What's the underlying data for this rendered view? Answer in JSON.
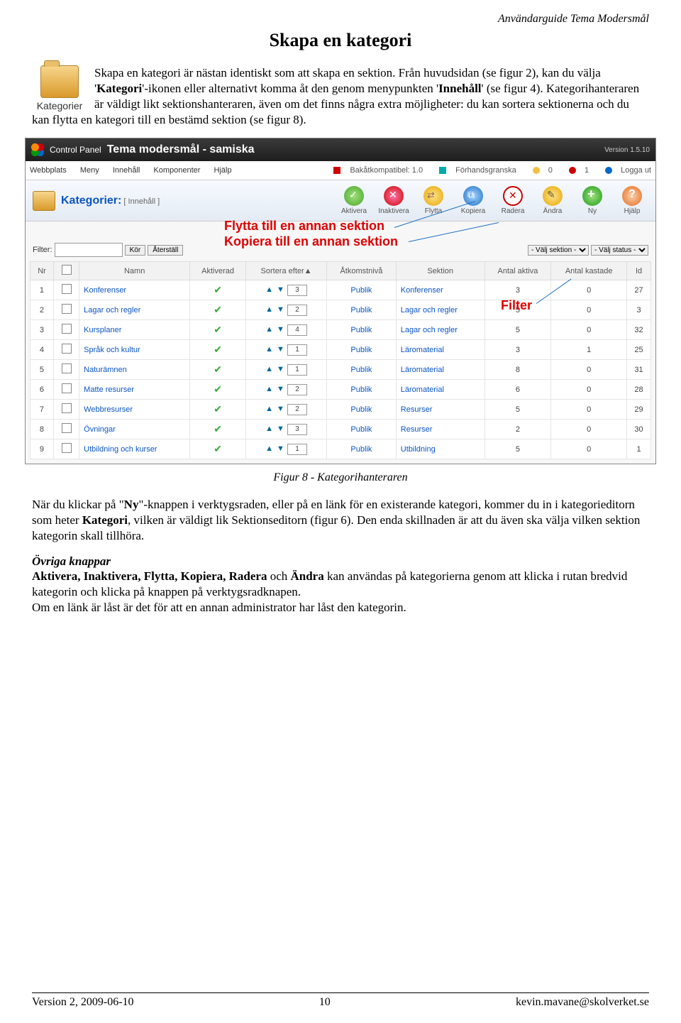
{
  "doc": {
    "header_right": "Användarguide Tema Modersmål",
    "title": "Skapa en kategori",
    "icon_caption": "Kategorier",
    "intro_1": "Skapa en kategori är nästan identiskt som att skapa en sektion. Från huvudsidan (se figur 2), kan du välja '",
    "intro_b1": "Kategori",
    "intro_2": "'-ikonen eller alternativt komma åt den genom menypunkten '",
    "intro_b2": "Innehåll",
    "intro_3": "' (se figur 4). Kategorihanteraren är väldigt likt sektionshanteraren, även om det finns några extra möjligheter: du kan sortera sektionerna och du kan flytta en kategori till en bestämd sektion (se figur 8).",
    "caption": "Figur 8 - Kategorihanteraren",
    "p2_1": "När du klickar på \"",
    "p2_b1": "Ny",
    "p2_2": "\"-knappen i verktygsraden, eller på en länk för en existerande kategori, kommer du in i kategorieditorn som heter ",
    "p2_b2": "Kategori",
    "p2_3": ", vilken är väldigt lik Sektionseditorn (figur 6). Den enda skillnaden är att du även ska välja vilken sektion kategorin skall tillhöra.",
    "p3_h": "Övriga knappar",
    "p3_b": "Aktivera, Inaktivera, Flytta,  Kopiera, Radera",
    "p3_1": " och ",
    "p3_b2": "Ändra",
    "p3_2": " kan användas på kategorierna genom att klicka i rutan bredvid kategorin och klicka på knappen på verktygsradknapen.",
    "p3_3": "Om en länk är låst är det för att en annan administrator har låst den kategorin.",
    "footer_left": "Version 2, 2009-06-10",
    "footer_center": "10",
    "footer_right": "kevin.mavane@skolverket.se"
  },
  "cp": {
    "label": "Control Panel",
    "title": "Tema modersmål - samiska",
    "version": "Version 1.5.10",
    "menus": [
      "Webbplats",
      "Meny",
      "Innehåll",
      "Komponenter",
      "Hjälp"
    ],
    "status": {
      "compat": "Bakåtkompatibel: 1.0",
      "preview": "Förhandsgranska",
      "v0": "0",
      "v1": "1",
      "logout": "Logga ut"
    },
    "section_title": "Kategorier:",
    "section_sub": "[ Innehåll ]",
    "toolbar": [
      {
        "name": "aktivera",
        "label": "Aktivera",
        "cls": "ic-green"
      },
      {
        "name": "inaktivera",
        "label": "Inaktivera",
        "cls": "ic-red"
      },
      {
        "name": "flytta",
        "label": "Flytta",
        "cls": "ic-yel"
      },
      {
        "name": "kopiera",
        "label": "Kopiera",
        "cls": "ic-blue"
      },
      {
        "name": "radera",
        "label": "Radera",
        "cls": "ic-x"
      },
      {
        "name": "andra",
        "label": "Ändra",
        "cls": "ic-pen"
      },
      {
        "name": "ny",
        "label": "Ny",
        "cls": "ic-plus"
      },
      {
        "name": "hjalp",
        "label": "Hjälp",
        "cls": "ic-help"
      }
    ],
    "annot1": "Flytta till en annan sektion",
    "annot2": "Kopiera till en annan sektion",
    "annot3": "Filter",
    "filter_label": "Filter:",
    "btn_kor": "Kör",
    "btn_aterstall": "Återställ",
    "sel_sektion": "- Välj sektion -",
    "sel_status": "- Välj status -",
    "columns": {
      "nr": "Nr",
      "namn": "Namn",
      "aktiverad": "Aktiverad",
      "sortera": "Sortera efter▲",
      "atkomst": "Åtkomstnivå",
      "sektion": "Sektion",
      "antal_aktiva": "Antal aktiva",
      "antal_kastade": "Antal kastade",
      "id": "Id"
    },
    "rows": [
      {
        "nr": "1",
        "namn": "Konferenser",
        "sort": "3",
        "atk": "Publik",
        "sek": "Konferenser",
        "aa": "3",
        "ak": "0",
        "id": "27"
      },
      {
        "nr": "2",
        "namn": "Lagar och regler",
        "sort": "2",
        "atk": "Publik",
        "sek": "Lagar och regler",
        "aa": "5",
        "ak": "0",
        "id": "3"
      },
      {
        "nr": "3",
        "namn": "Kursplaner",
        "sort": "4",
        "atk": "Publik",
        "sek": "Lagar och regler",
        "aa": "5",
        "ak": "0",
        "id": "32"
      },
      {
        "nr": "4",
        "namn": "Språk och kultur",
        "sort": "1",
        "atk": "Publik",
        "sek": "Läromaterial",
        "aa": "3",
        "ak": "1",
        "id": "25"
      },
      {
        "nr": "5",
        "namn": "Naturämnen",
        "sort": "1",
        "atk": "Publik",
        "sek": "Läromaterial",
        "aa": "8",
        "ak": "0",
        "id": "31"
      },
      {
        "nr": "6",
        "namn": "Matte resurser",
        "sort": "2",
        "atk": "Publik",
        "sek": "Läromaterial",
        "aa": "6",
        "ak": "0",
        "id": "28"
      },
      {
        "nr": "7",
        "namn": "Webbresurser",
        "sort": "2",
        "atk": "Publik",
        "sek": "Resurser",
        "aa": "5",
        "ak": "0",
        "id": "29"
      },
      {
        "nr": "8",
        "namn": "Övningar",
        "sort": "3",
        "atk": "Publik",
        "sek": "Resurser",
        "aa": "2",
        "ak": "0",
        "id": "30"
      },
      {
        "nr": "9",
        "namn": "Utbildning och kurser",
        "sort": "1",
        "atk": "Publik",
        "sek": "Utbildning",
        "aa": "5",
        "ak": "0",
        "id": "1"
      }
    ]
  }
}
